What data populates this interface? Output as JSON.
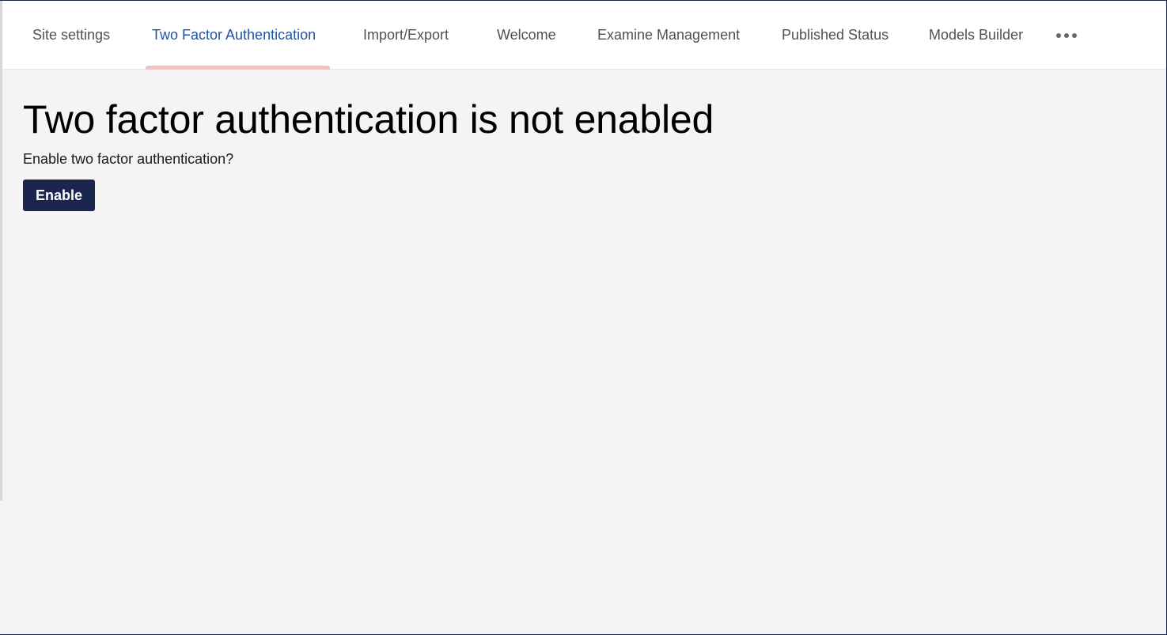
{
  "tabs": [
    {
      "label": "Site settings",
      "active": false
    },
    {
      "label": "Two Factor Authentication",
      "active": true
    },
    {
      "label": "Import/Export",
      "active": false
    },
    {
      "label": "Welcome",
      "active": false
    },
    {
      "label": "Examine Management",
      "active": false
    },
    {
      "label": "Published Status",
      "active": false
    },
    {
      "label": "Models Builder",
      "active": false
    }
  ],
  "more_icon": "ellipsis-horizontal-icon",
  "main": {
    "title": "Two factor authentication is not enabled",
    "subtitle": "Enable two factor authentication?",
    "enable_label": "Enable"
  },
  "colors": {
    "active_tab": "#2152a3",
    "tab_indicator": "#f5c1bc",
    "primary_button": "#1b264f",
    "page_background": "#f5f3f4"
  }
}
